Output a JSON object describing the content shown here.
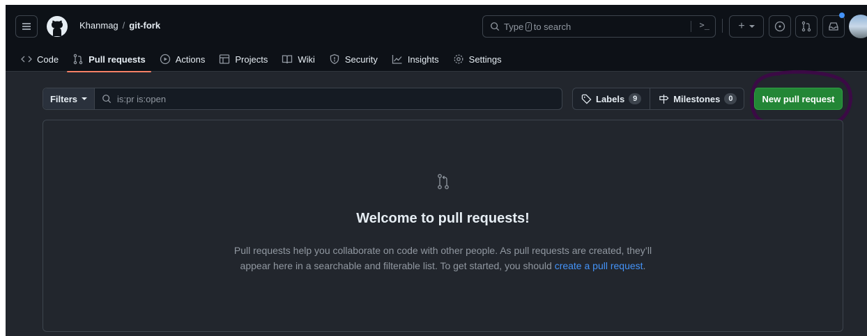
{
  "header": {
    "owner": "Khanmag",
    "separator": "/",
    "repo": "git-fork",
    "search_prefix": "Type",
    "search_key": "/",
    "search_suffix": "to search",
    "command_palette": ">_",
    "plus_label": "+"
  },
  "nav": {
    "code": "Code",
    "pull_requests": "Pull requests",
    "actions": "Actions",
    "projects": "Projects",
    "wiki": "Wiki",
    "security": "Security",
    "insights": "Insights",
    "settings": "Settings"
  },
  "toolbar": {
    "filters_label": "Filters",
    "filter_query": "is:pr is:open",
    "labels_label": "Labels",
    "labels_count": "9",
    "milestones_label": "Milestones",
    "milestones_count": "0",
    "new_pr_label": "New pull request"
  },
  "blankslate": {
    "title": "Welcome to pull requests!",
    "line1": "Pull requests help you collaborate on code with other people. As pull requests are created, they’ll",
    "line2_prefix": "appear here in a searchable and filterable list. To get started, you should ",
    "link": "create a pull request",
    "line2_suffix": "."
  },
  "colors": {
    "accent_green": "#238636",
    "active_tab_underline": "#f78166",
    "link_blue": "#4493f8",
    "annotation_purple": "#3b0a45"
  }
}
